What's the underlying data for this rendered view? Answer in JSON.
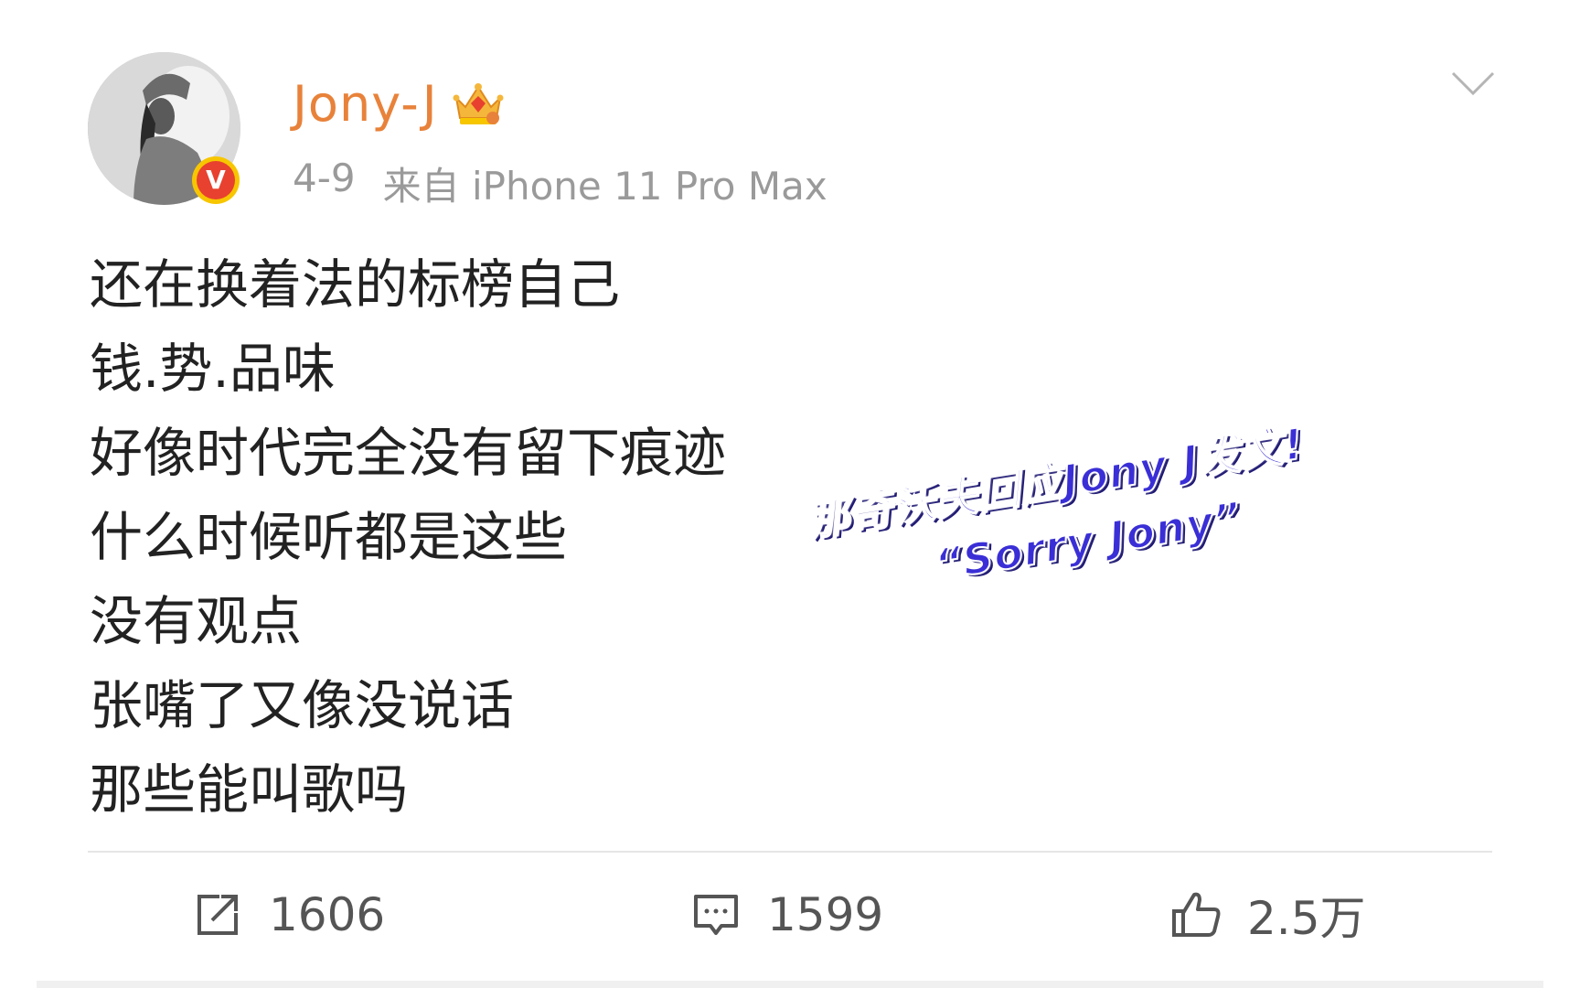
{
  "post": {
    "author": {
      "name": "Jony-J",
      "avatar_icon": "avatar-photo",
      "verified_badge": "V",
      "membership_icon": "crown-icon"
    },
    "meta": {
      "date": "4-9",
      "source": "来自 iPhone 11 Pro Max"
    },
    "content_lines": [
      "还在换着法的标榜自己",
      "钱.势.品味",
      "好像时代完全没有留下痕迹",
      "什么时候听都是这些",
      "没有观点",
      "张嘴了又像没说话",
      "那些能叫歌吗"
    ],
    "overlay_caption": {
      "line1": "那奇沃夫回应Jony J发文!",
      "line2": "“Sorry Jony”"
    },
    "actions": {
      "repost_count": "1606",
      "comment_count": "1599",
      "like_count": "2.5万"
    }
  },
  "colors": {
    "username": "#e8823a",
    "meta": "#9a9a9a",
    "text": "#222222",
    "caption": "#3a2fd6",
    "badge": "#e8412f"
  }
}
